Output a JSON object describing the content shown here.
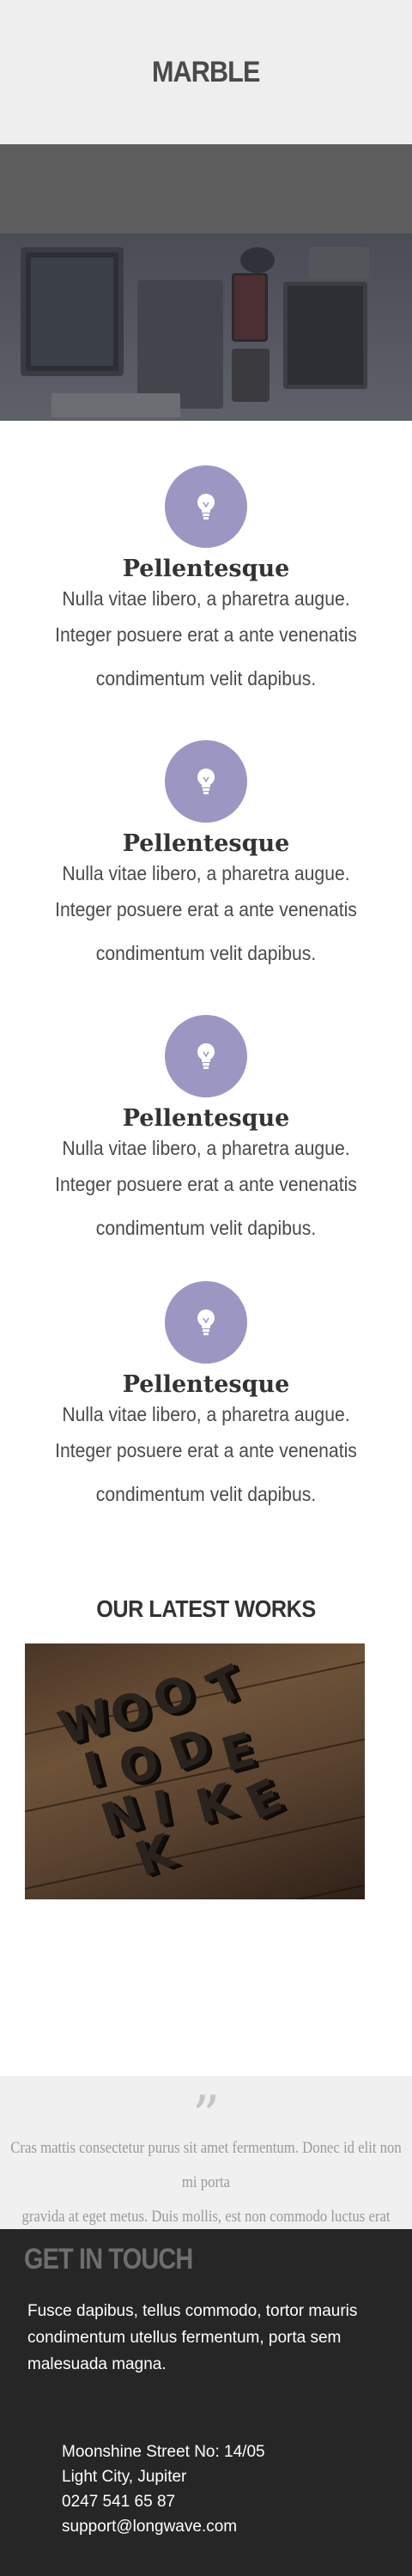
{
  "header": {
    "brand": "MARBLE"
  },
  "features": [
    {
      "icon": "lightbulb-icon",
      "title": "Pellentesque",
      "line1": "Nulla vitae  libero, a pharetra augue.",
      "line2": "Integer posuere erat a ante venenatis",
      "line3": "condimentum velit dapibus."
    },
    {
      "icon": "lightbulb-icon",
      "title": "Pellentesque",
      "line1": "Nulla vitae  libero, a pharetra augue.",
      "line2": "Integer posuere erat a ante venenatis",
      "line3": "condimentum velit dapibus."
    },
    {
      "icon": "lightbulb-icon",
      "title": "Pellentesque",
      "line1": "Nulla vitae  libero, a pharetra augue.",
      "line2": "Integer posuere erat a ante venenatis",
      "line3": "condimentum velit dapibus."
    },
    {
      "icon": "lightbulb-icon",
      "title": "Pellentesque",
      "line1": "Nulla vitae  libero, a pharetra augue.",
      "line2": "Integer posuere erat a ante venenatis",
      "line3": "condimentum velit dapibus."
    }
  ],
  "works": {
    "title": "OUR LATEST WORKS",
    "image_word": "WOODINK"
  },
  "testimonial": {
    "icon": "quote-icon",
    "line1": "Cras mattis consectetur purus sit amet fermentum. Donec id elit non mi porta",
    "line2": "gravida at eget metus. Duis mollis, est non commodo luctus erat porttitor."
  },
  "footer": {
    "title": "GET IN TOUCH",
    "description": "Fusce dapibus, tellus commodo, tortor mauris condimentum utellus fermentum, porta sem malesuada magna.",
    "address": "Moonshine Street No: 14/05",
    "city": "Light City, Jupiter",
    "phone": "0247 541 65 87",
    "email": "support@longwave.com"
  },
  "colors": {
    "accent": "#9b97c2",
    "footer_bg": "#262626",
    "header_bg": "#eeeeee"
  }
}
